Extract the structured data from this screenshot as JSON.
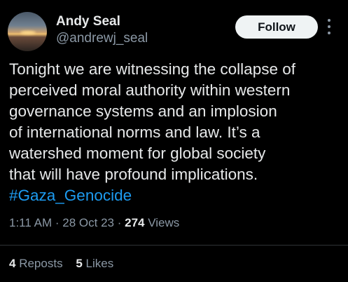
{
  "author": {
    "name": "Andy Seal",
    "handle": "@andrewj_seal"
  },
  "actions": {
    "follow_label": "Follow"
  },
  "tweet": {
    "lines": [
      "Tonight we are witnessing the collapse of",
      "perceived moral authority within western",
      "governance systems and an implosion",
      "of international norms and law. It’s a",
      "watershed moment for global society",
      "that will have profound implications."
    ],
    "hashtag": "#Gaza_Genocide"
  },
  "meta": {
    "time": "1:11 AM",
    "separator": "·",
    "date": "28 Oct 23",
    "views_count": "274",
    "views_label": "Views"
  },
  "stats": {
    "reposts_count": "4",
    "reposts_label": "Reposts",
    "likes_count": "5",
    "likes_label": "Likes"
  },
  "colors": {
    "background": "#000000",
    "text": "#e7e9ea",
    "secondary": "#8b98a5",
    "link": "#1d9bf0",
    "button_bg": "#eff3f4"
  },
  "icons": {
    "more": "more-vertical-icon"
  }
}
